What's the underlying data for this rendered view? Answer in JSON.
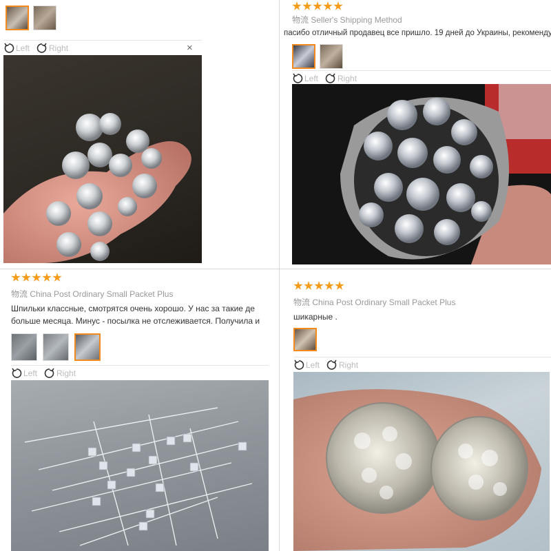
{
  "panels": {
    "top_left": {
      "rotate_left": "Left",
      "rotate_right": "Right",
      "close": "×",
      "thumbnails": 2
    },
    "top_right": {
      "rating": 5,
      "shipping_cn": "物流",
      "shipping": "Seller's Shipping Method",
      "review": "пасибо отличный продавец все пришло. 19 дней до Украины, рекомендую",
      "rotate_left": "Left",
      "rotate_right": "Right"
    },
    "bottom_left": {
      "rating": 5,
      "shipping_cn": "物流",
      "shipping": "China Post Ordinary Small Packet Plus",
      "review_line1": "Шпильки классные, смотрятся очень хорошо. У нас за такие де",
      "review_line2": "больше месяца. Минус - посылка не отслеживается. Получила и",
      "rotate_left": "Left",
      "rotate_right": "Right"
    },
    "bottom_right": {
      "rating": 5,
      "shipping_cn": "物流",
      "shipping": "China Post Ordinary Small Packet Plus",
      "review": "шикарные .",
      "rotate_left": "Left",
      "rotate_right": "Right"
    }
  },
  "colors": {
    "star": "#f59b1a",
    "thumb_active_border": "#f28a1e"
  },
  "icons": {
    "rotate_left": "rotate-left-icon",
    "rotate_right": "rotate-right-icon",
    "close": "close-icon"
  }
}
